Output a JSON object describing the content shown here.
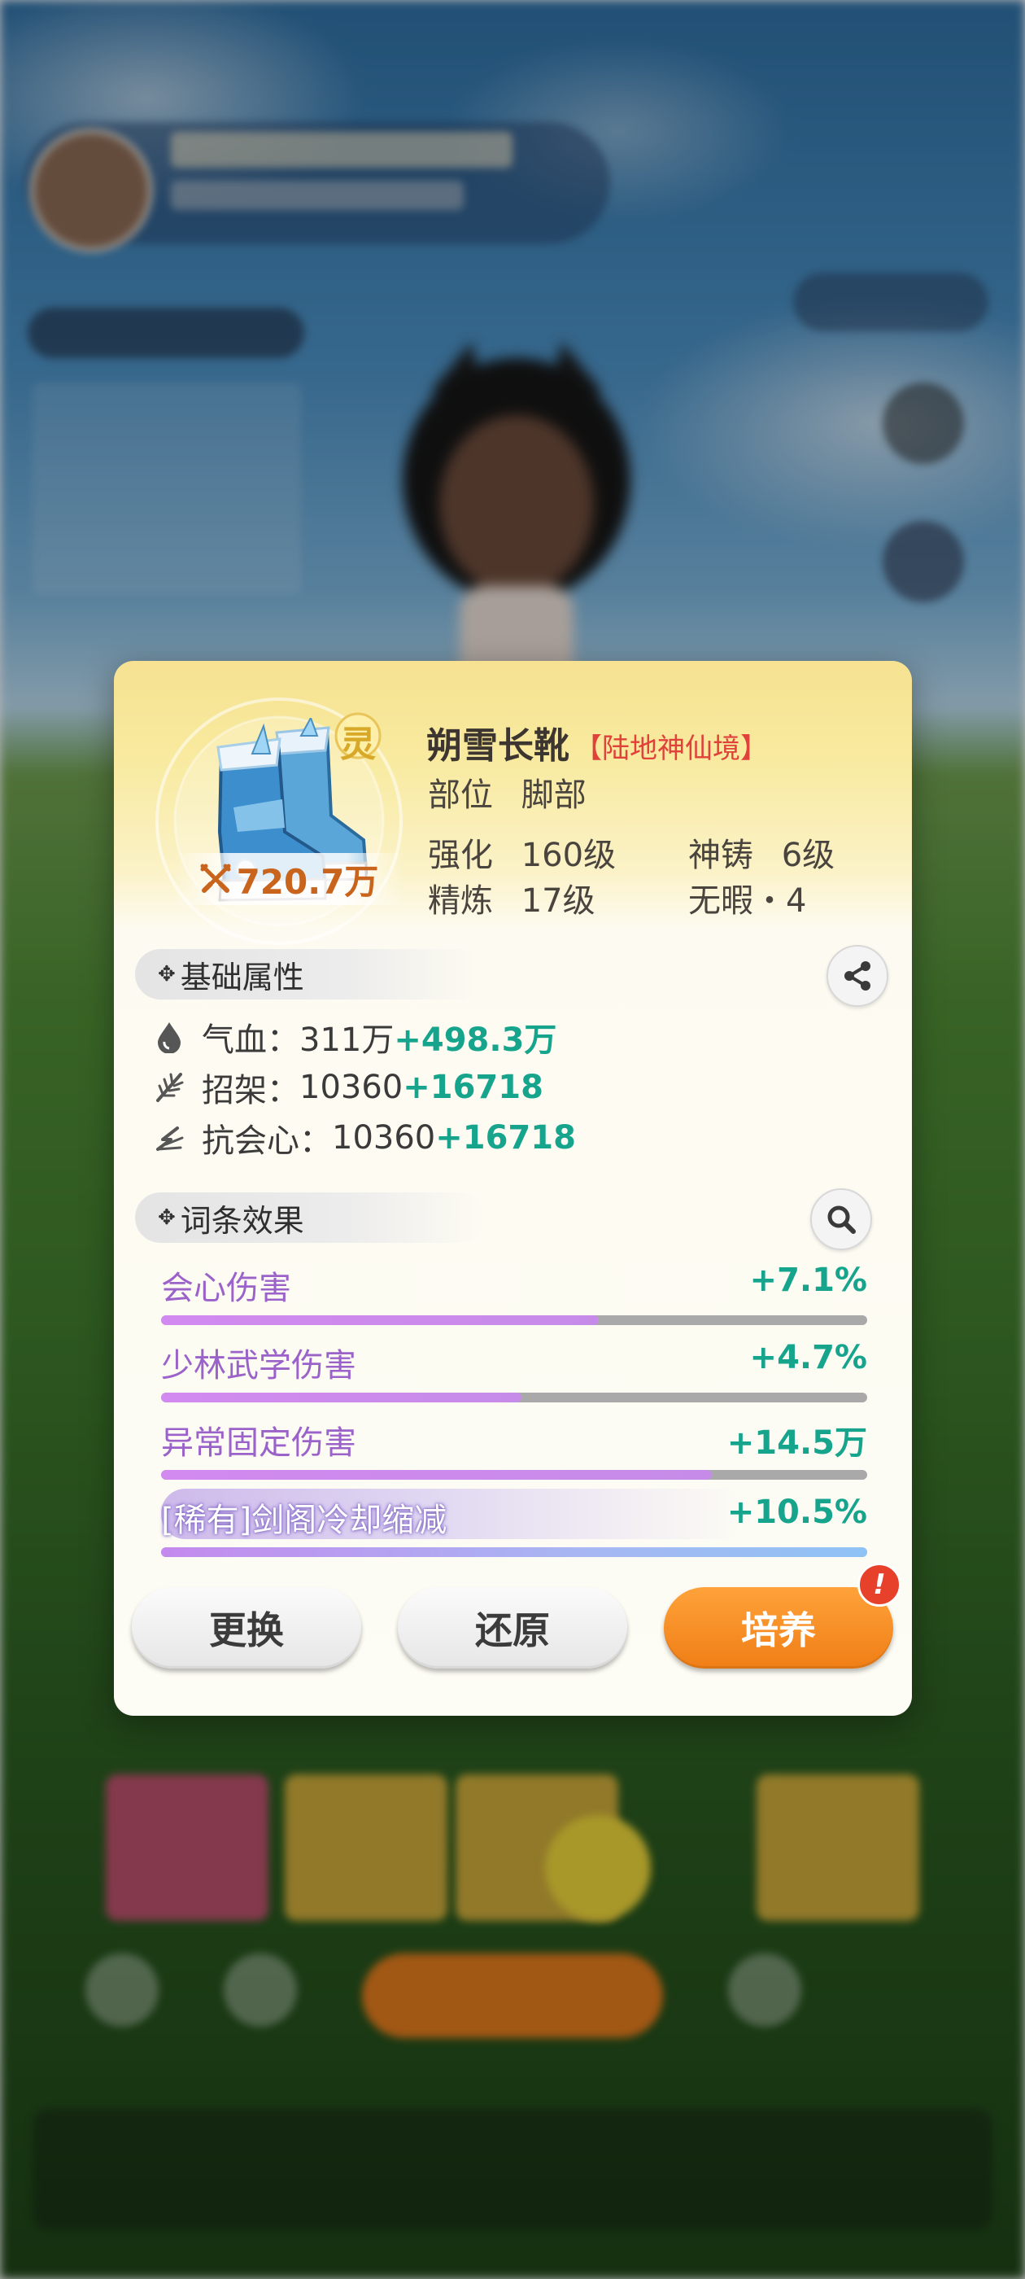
{
  "item": {
    "name": "朔雪长靴",
    "realm": "【陆地神仙境】",
    "badge": "灵",
    "power": "720.7万",
    "slot_label": "部位",
    "slot_value": "脚部",
    "enhance_label": "强化",
    "enhance_value": "160级",
    "divine_label": "神铸",
    "divine_value": "6级",
    "refine_label": "精炼",
    "refine_value": "17级",
    "flawless": "无暇・4"
  },
  "basic_section": {
    "title": "基础属性",
    "attrs": [
      {
        "label": "气血：",
        "base": "311万",
        "bonus": "+498.3万",
        "icon": "blood-drop-icon"
      },
      {
        "label": "招架：",
        "base": "10360",
        "bonus": "+16718",
        "icon": "parry-wing-icon"
      },
      {
        "label": "抗会心：",
        "base": "10360",
        "bonus": "+16718",
        "icon": "anti-crit-icon"
      }
    ]
  },
  "effects_section": {
    "title": "词条效果",
    "effects": [
      {
        "name": "会心伤害",
        "value": "+7.1%",
        "fill_fraction": 0.62
      },
      {
        "name": "少林武学伤害",
        "value": "+4.7%",
        "fill_fraction": 0.51
      },
      {
        "name": "异常固定伤害",
        "value": "+14.5万",
        "fill_fraction": 0.78
      },
      {
        "name": "[稀有]剑阁冷却缩减",
        "value": "+10.5%",
        "fill_fraction": 1.0,
        "rare": true
      }
    ]
  },
  "buttons": {
    "replace": "更换",
    "restore": "还原",
    "cultivate": "培养",
    "alert": "!"
  },
  "colors": {
    "bonus_green": "#16a58c",
    "effect_purple": "#9b62c9",
    "realm_red": "#e0413b",
    "power_orange": "#c9641d",
    "primary_orange": "#f07e16"
  }
}
